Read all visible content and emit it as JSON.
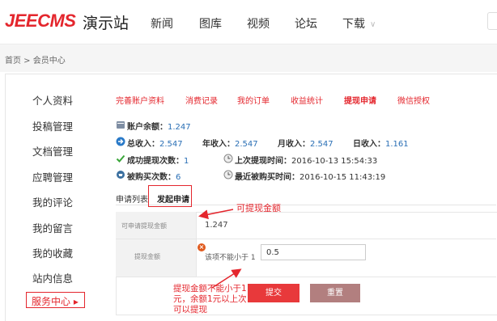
{
  "header": {
    "logo": "JEECMS",
    "site_name": "演示站",
    "nav": [
      "新闻",
      "图库",
      "视频",
      "论坛",
      "下载"
    ]
  },
  "breadcrumb": "首页 > 会员中心",
  "sidebar": {
    "items": [
      "个人资料",
      "投稿管理",
      "文档管理",
      "应聘管理",
      "我的评论",
      "我的留言",
      "我的收藏",
      "站内信息"
    ],
    "active": "服务中心 ▸"
  },
  "top_tabs": [
    "完善账户资料",
    "消费记录",
    "我的订单",
    "收益统计",
    "提现申请",
    "微信授权"
  ],
  "stats": {
    "balance_label": "账户余额：",
    "balance": "1.247",
    "total_income_label": "总收入：",
    "total_income": "2.547",
    "year_income_label": "年收入：",
    "year_income": "2.547",
    "month_income_label": "月收入：",
    "month_income": "2.547",
    "day_income_label": "日收入：",
    "day_income": "1.161",
    "withdraw_count_label": "成功提现次数：",
    "withdraw_count": "1",
    "last_withdraw_label": "上次提现时间：",
    "last_withdraw": "2016-10-13 15:54:33",
    "bought_count_label": "被购买次数：",
    "bought_count": "6",
    "last_bought_label": "最近被购买时间：",
    "last_bought": "2016-10-15 11:43:19"
  },
  "sub_tabs": [
    "申请列表",
    "发起申请"
  ],
  "form": {
    "available_label": "可申请提现金额",
    "available_value": "1.247",
    "amount_label": "提现金额",
    "amount_value": "0.5",
    "warning": "该项不能小于 1",
    "submit": "提交",
    "reset": "重置"
  },
  "annotations": {
    "note1": "可提现金额",
    "note2": "提现金额不能小于1元，余额1元以上次可以提现"
  },
  "colors": {
    "brand_red": "#e4262d",
    "link_blue": "#2a6fb5",
    "submit_bg": "#e8393b",
    "reset_bg": "#b27f7f"
  }
}
